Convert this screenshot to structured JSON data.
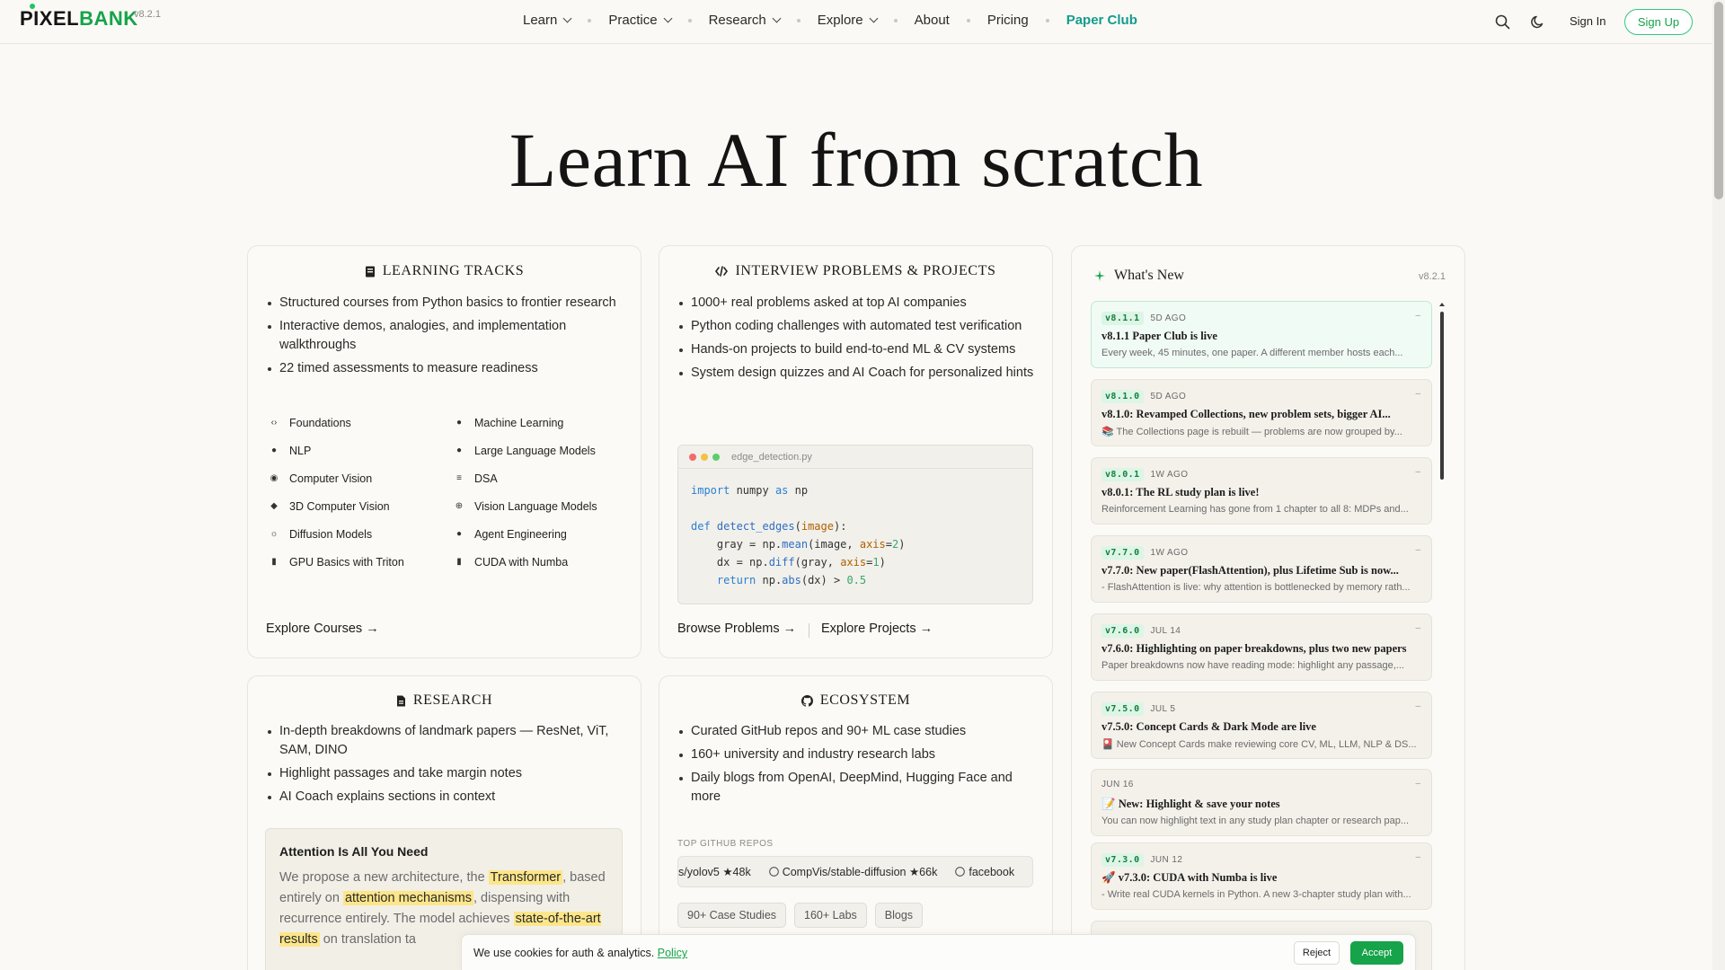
{
  "brand": {
    "name_part1": "PIXEL",
    "name_part2": "BANK",
    "version": "v8.2.1"
  },
  "nav": {
    "links": [
      {
        "label": "Learn",
        "dropdown": true
      },
      {
        "label": "Practice",
        "dropdown": true
      },
      {
        "label": "Research",
        "dropdown": true
      },
      {
        "label": "Explore",
        "dropdown": true
      },
      {
        "label": "About",
        "dropdown": false
      },
      {
        "label": "Pricing",
        "dropdown": false
      },
      {
        "label": "Paper Club",
        "dropdown": false
      }
    ],
    "sign_in": "Sign In",
    "sign_up": "Sign Up",
    "icons": [
      "search-icon",
      "moon-icon"
    ]
  },
  "hero": {
    "title": "Learn AI from scratch"
  },
  "learning": {
    "title": "LEARNING TRACKS",
    "bullets": [
      "Structured courses from Python basics to frontier research",
      "Interactive demos, analogies, and implementation walkthroughs",
      "22 timed assessments to measure readiness"
    ],
    "tracks": [
      "Foundations",
      "Machine Learning",
      "NLP",
      "Large Language Models",
      "Computer Vision",
      "DSA",
      "3D Computer Vision",
      "Vision Language Models",
      "Diffusion Models",
      "Agent Engineering",
      "GPU Basics with Triton",
      "CUDA with Numba"
    ],
    "link": "Explore Courses →"
  },
  "interview": {
    "title": "INTERVIEW PROBLEMS & PROJECTS",
    "bullets": [
      "1000+ real problems asked at top AI companies",
      "Python coding challenges with automated test verification",
      "Hands-on projects to build end-to-end ML & CV systems",
      "System design quizzes and AI Coach for personalized hints"
    ],
    "code_file": "edge_detection.py",
    "link_problems": "Browse Problems →",
    "link_projects": "Explore Projects →"
  },
  "research": {
    "title": "RESEARCH",
    "bullets": [
      "In-depth breakdowns of landmark papers — ResNet, ViT, SAM, DINO",
      "Highlight passages and take margin notes",
      "AI Coach explains sections in context"
    ],
    "paper_title": "Attention Is All You Need",
    "paper_text": {
      "t1": "We propose a new architecture, the ",
      "h1": "Transformer",
      "t2": ", based entirely on ",
      "h2": "attention mechanisms",
      "t3": ", dispensing with recurrence entirely. The model achieves ",
      "h3": "state-of-the-art results",
      "t4": " on translation ta"
    }
  },
  "ecosystem": {
    "title": "ECOSYSTEM",
    "bullets": [
      "Curated GitHub repos and 90+ ML case studies",
      "160+ university and industry research labs",
      "Daily blogs from OpenAI, DeepMind, Hugging Face and more"
    ],
    "repos_label": "TOP GITHUB REPOS",
    "repos": [
      "s/yolov5 ★48k",
      "CompVis/stable-diffusion ★66k",
      "facebook"
    ],
    "chips": [
      "90+ Case Studies",
      "160+ Labs",
      "Blogs"
    ]
  },
  "whats_new": {
    "title": "What's New",
    "version": "v8.2.1",
    "items": [
      {
        "tag": "v8.1.1",
        "when": "5D AGO",
        "title": "v8.1.1 Paper Club is live",
        "desc": "Every week, 45 minutes, one paper. A different member hosts each..."
      },
      {
        "tag": "v8.1.0",
        "when": "5D AGO",
        "title": "v8.1.0: Revamped Collections, new problem sets, bigger AI...",
        "desc": "📚 The Collections page is rebuilt — problems are now grouped by..."
      },
      {
        "tag": "v8.0.1",
        "when": "1W AGO",
        "title": "v8.0.1: The RL study plan is live!",
        "desc": "Reinforcement Learning has gone from 1 chapter to all 8: MDPs and..."
      },
      {
        "tag": "v7.7.0",
        "when": "1W AGO",
        "title": "v7.7.0: New paper(FlashAttention), plus Lifetime Sub is now...",
        "desc": "- FlashAttention is live: why attention is bottlenecked by memory rath..."
      },
      {
        "tag": "v7.6.0",
        "when": "JUL 14",
        "title": "v7.6.0: Highlighting on paper breakdowns, plus two new papers",
        "desc": "Paper breakdowns now have reading mode: highlight any passage,..."
      },
      {
        "tag": "v7.5.0",
        "when": "JUL 5",
        "title": "v7.5.0: Concept Cards & Dark Mode are live",
        "desc": "🎴 New Concept Cards make reviewing core CV, ML, LLM, NLP & DS..."
      },
      {
        "tag": "",
        "when": "JUN 16",
        "title": "📝 New: Highlight & save your notes",
        "desc": "You can now highlight text in any study plan chapter or research pap..."
      },
      {
        "tag": "v7.3.0",
        "when": "JUN 12",
        "title": "🚀 v7.3.0: CUDA with Numba is live",
        "desc": "- Write real CUDA kernels in Python. A new 3-chapter study plan with..."
      }
    ]
  },
  "cookie": {
    "text": "We use cookies for auth & analytics.",
    "policy": "Policy",
    "reject": "Reject",
    "accept": "Accept"
  }
}
